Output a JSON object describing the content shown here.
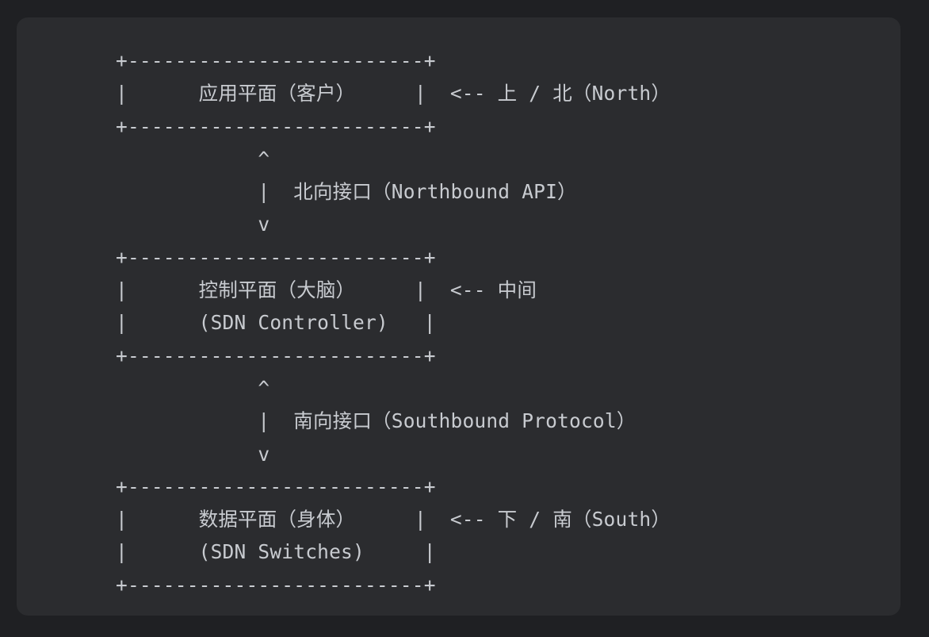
{
  "diagram": {
    "lines": [
      "+-------------------------+",
      "|      应用平面（客户）     |  <-- 上 / 北（North）",
      "+-------------------------+",
      "            ^",
      "            |  北向接口（Northbound API）",
      "            v",
      "+-------------------------+",
      "|      控制平面（大脑）     |  <-- 中间",
      "|      (SDN Controller)   |",
      "+-------------------------+",
      "            ^",
      "            |  南向接口（Southbound Protocol）",
      "            v",
      "+-------------------------+",
      "|      数据平面（身体）     |  <-- 下 / 南（South）",
      "|      (SDN Switches)     |",
      "+-------------------------+"
    ]
  }
}
